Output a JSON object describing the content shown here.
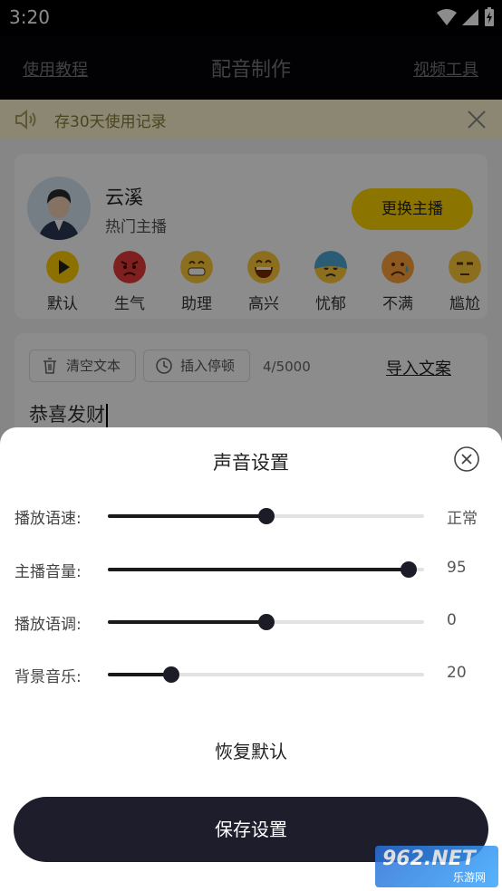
{
  "status_bar": {
    "time": "3:20"
  },
  "header": {
    "left_link": "使用教程",
    "title": "配音制作",
    "right_link": "视频工具"
  },
  "notice": {
    "text": "存30天使用记录"
  },
  "anchor": {
    "name": "云溪",
    "tag": "热门主播",
    "change_button": "更换主播",
    "emotions": [
      {
        "label": "默认",
        "icon": "play-icon",
        "color": "#ffcc00"
      },
      {
        "label": "生气",
        "icon": "angry-face-icon",
        "color": "#e63b3b"
      },
      {
        "label": "助理",
        "icon": "grin-face-icon",
        "color": "#ffc83a"
      },
      {
        "label": "高兴",
        "icon": "laugh-face-icon",
        "color": "#ffc83a"
      },
      {
        "label": "忧郁",
        "icon": "sad-cold-face-icon",
        "color": "#4fa8d8"
      },
      {
        "label": "不满",
        "icon": "worried-face-icon",
        "color": "#ffc83a"
      },
      {
        "label": "尴尬",
        "icon": "unamused-face-icon",
        "color": "#ffc83a"
      }
    ]
  },
  "editor": {
    "clear_button": "清空文本",
    "pause_button": "插入停顿",
    "counter": "4/5000",
    "import_link": "导入文案",
    "text": "恭喜发财"
  },
  "sound_settings": {
    "title": "声音设置",
    "rows": [
      {
        "label": "播放语速:",
        "value": "正常",
        "level": 0.5
      },
      {
        "label": "主播音量:",
        "value": "95",
        "level": 0.95
      },
      {
        "label": "播放语调:",
        "value": "0",
        "level": 0.5
      },
      {
        "label": "背景音乐:",
        "value": "20",
        "level": 0.2
      }
    ],
    "reset_label": "恢复默认",
    "save_label": "保存设置"
  },
  "watermark": {
    "main": "962.NET",
    "sub": "乐游网"
  },
  "colors": {
    "accent": "#ffd400",
    "dark_button": "#1e1d2b",
    "header_bg": "#050508"
  }
}
